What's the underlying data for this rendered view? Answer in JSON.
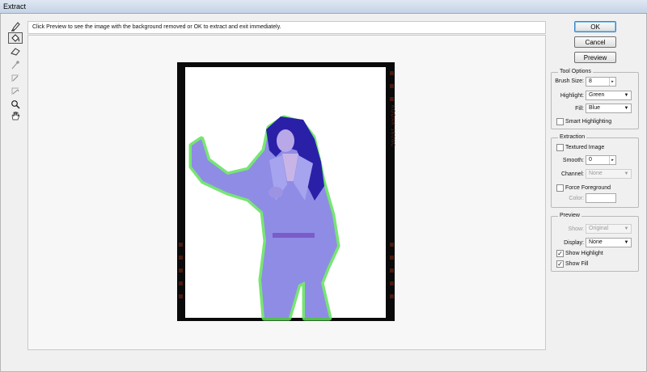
{
  "window": {
    "title": "Extract"
  },
  "hint": "Click Preview to see the image with the background removed or OK to extract and exit immediately.",
  "film_edge_text": "KODAK 160NC",
  "buttons": {
    "ok": "OK",
    "cancel": "Cancel",
    "preview": "Preview"
  },
  "tool_options": {
    "legend": "Tool Options",
    "brush_size_label": "Brush Size:",
    "brush_size_value": "8",
    "highlight_label": "Highlight:",
    "highlight_value": "Green",
    "fill_label": "Fill:",
    "fill_value": "Blue",
    "smart_highlighting_label": "Smart Highlighting",
    "smart_highlighting_checked": false
  },
  "extraction": {
    "legend": "Extraction",
    "textured_image_label": "Textured Image",
    "textured_image_checked": false,
    "smooth_label": "Smooth:",
    "smooth_value": "0",
    "channel_label": "Channel:",
    "channel_value": "None",
    "force_foreground_label": "Force Foreground",
    "force_foreground_checked": false,
    "color_label": "Color:"
  },
  "preview": {
    "legend": "Preview",
    "show_label": "Show:",
    "show_value": "Original",
    "display_label": "Display:",
    "display_value": "None",
    "show_highlight_label": "Show Highlight",
    "show_highlight_checked": true,
    "show_fill_label": "Show Fill",
    "show_fill_checked": true
  },
  "colors": {
    "highlight": "#5fe05a",
    "fill": "#6a67d8",
    "accent": "#3a86c8"
  },
  "icons": [
    "edge-highlighter-icon",
    "fill-bucket-icon",
    "eraser-icon",
    "eyedropper-icon",
    "cleanup-icon",
    "edge-touchup-icon",
    "zoom-icon",
    "hand-icon"
  ]
}
